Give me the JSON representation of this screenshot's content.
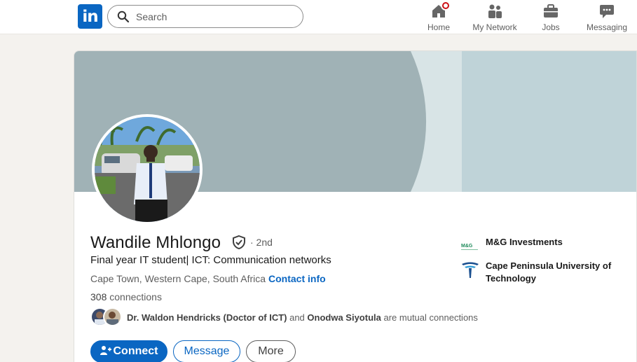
{
  "nav": {
    "logo_text": "in",
    "search_placeholder": "Search",
    "items": [
      {
        "label": "Home",
        "icon": "home-icon"
      },
      {
        "label": "My Network",
        "icon": "network-icon"
      },
      {
        "label": "Jobs",
        "icon": "jobs-icon"
      },
      {
        "label": "Messaging",
        "icon": "messaging-icon"
      }
    ]
  },
  "profile": {
    "name": "Wandile Mhlongo",
    "degree": "· 2nd",
    "headline": "Final year IT student| ICT: Communication networks",
    "location": "Cape Town, Western Cape, South Africa ·",
    "contact_info": "Contact info",
    "connections_count": "308",
    "connections_label": " connections",
    "mutual": {
      "person1": "Dr. Waldon Hendricks (Doctor of ICT)",
      "and": " and ",
      "person2": "Onodwa Siyotula",
      "suffix": " are mutual connections"
    }
  },
  "actions": {
    "connect": "Connect",
    "message": "Message",
    "more": "More"
  },
  "organizations": [
    {
      "name": "M&G Investments",
      "logo_text": "M&G"
    },
    {
      "name": "Cape Peninsula University of Technology"
    }
  ],
  "colors": {
    "brand_blue": "#0a66c2",
    "banner_left": "#a0b2b6",
    "banner_right": "#bfd3d8",
    "notification_red": "#cc1016"
  }
}
